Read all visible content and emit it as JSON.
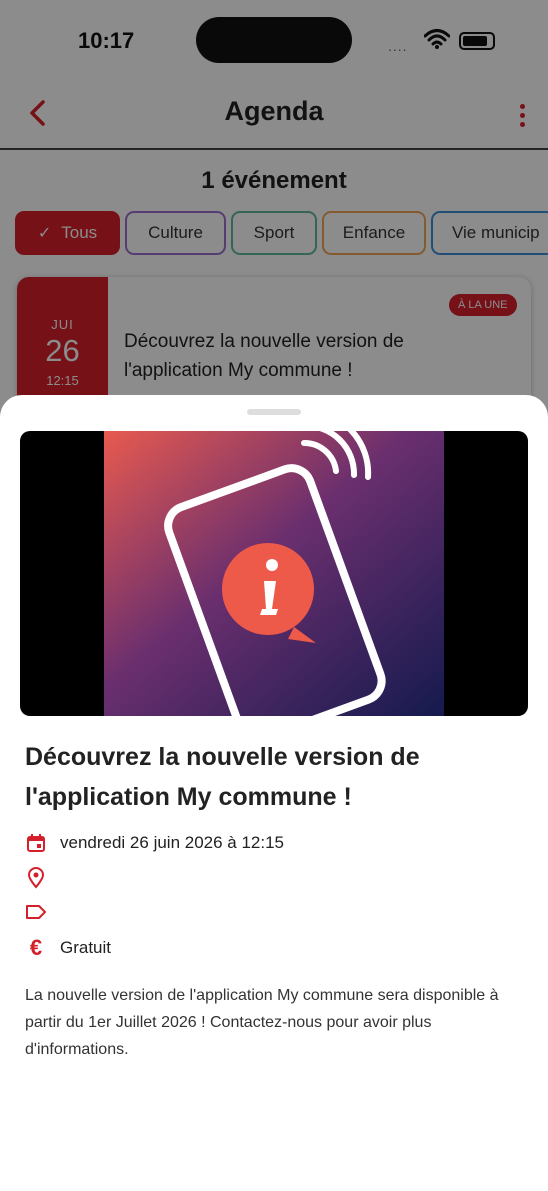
{
  "status_bar": {
    "time": "10:17",
    "dots": "....",
    "icons": [
      "wifi-icon",
      "battery-icon"
    ]
  },
  "header": {
    "title": "Agenda",
    "back_icon": "chevron-left-icon",
    "menu_icon": "more-vertical-icon"
  },
  "list": {
    "count_label": "1 événement",
    "filters": [
      {
        "label": "Tous",
        "active": true,
        "color": "#d51f2a"
      },
      {
        "label": "Culture",
        "active": false,
        "color": "#9b6fd0"
      },
      {
        "label": "Sport",
        "active": false,
        "color": "#5fb99e"
      },
      {
        "label": "Enfance",
        "active": false,
        "color": "#f0a45a"
      },
      {
        "label": "Vie municip",
        "active": false,
        "color": "#3b8fd6"
      }
    ],
    "events": [
      {
        "month": "JUI",
        "day": "26",
        "time": "12:15",
        "badge": "À LA UNE",
        "title": "Découvrez la nouvelle version de l'application My commune !"
      }
    ]
  },
  "sheet": {
    "image_icon": "info-bubble-phone-illustration",
    "title": "Découvrez la nouvelle version de l'application My commune !",
    "date_text": "vendredi 26 juin 2026 à 12:15",
    "location_text": "",
    "category_text": "",
    "price_text": "Gratuit",
    "description": "La nouvelle version de l'application My commune sera disponible à partir du 1er Juillet 2026 ! Contactez-nous pour avoir plus d'informations."
  },
  "colors": {
    "accent": "#d51f2a",
    "dim_overlay": "rgba(0,0,0,0.45)"
  }
}
